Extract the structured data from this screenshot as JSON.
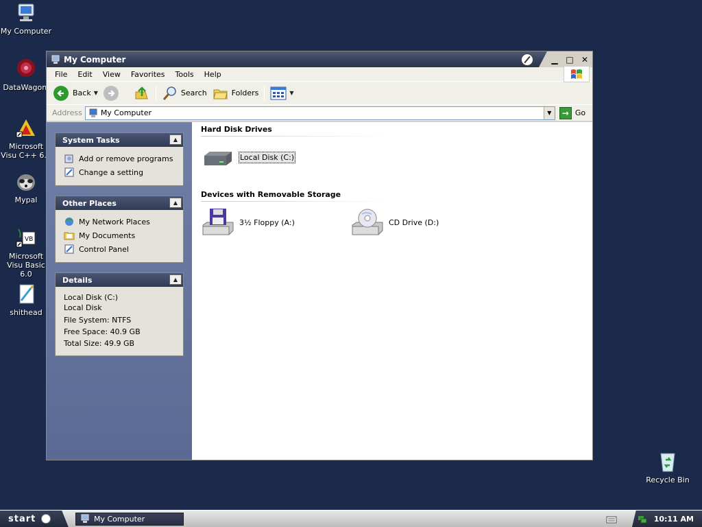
{
  "desktop": {
    "icons": [
      {
        "label": "My Computer"
      },
      {
        "label": "DataWagon."
      },
      {
        "label": "Microsoft Visu C++ 6.0"
      },
      {
        "label": "Mypal"
      },
      {
        "label": "Microsoft Visu Basic 6.0"
      },
      {
        "label": "shithead"
      },
      {
        "label": "Recycle Bin"
      }
    ]
  },
  "window": {
    "title": "My Computer",
    "menu": [
      "File",
      "Edit",
      "View",
      "Favorites",
      "Tools",
      "Help"
    ],
    "toolbar": {
      "back": "Back",
      "search": "Search",
      "folders": "Folders"
    },
    "address": {
      "label": "Address",
      "value": "My Computer",
      "go": "Go"
    },
    "taskpane": {
      "system_tasks": {
        "title": "System Tasks",
        "items": [
          "Add or remove programs",
          "Change a setting"
        ]
      },
      "other_places": {
        "title": "Other Places",
        "items": [
          "My Network Places",
          "My Documents",
          "Control Panel"
        ]
      },
      "details": {
        "title": "Details",
        "name": "Local Disk (C:)",
        "type": "Local Disk",
        "file_system": "File System: NTFS",
        "free_space": "Free Space: 40.9 GB",
        "total_size": "Total Size: 49.9 GB"
      }
    },
    "groups": {
      "hard_disks": {
        "title": "Hard Disk Drives",
        "items": [
          "Local Disk (C:)"
        ]
      },
      "removable": {
        "title": "Devices with Removable Storage",
        "items": [
          "3½ Floppy (A:)",
          "CD Drive (D:)"
        ]
      }
    }
  },
  "taskbar": {
    "start": "start",
    "task": "My Computer",
    "clock": "10:11 AM"
  }
}
